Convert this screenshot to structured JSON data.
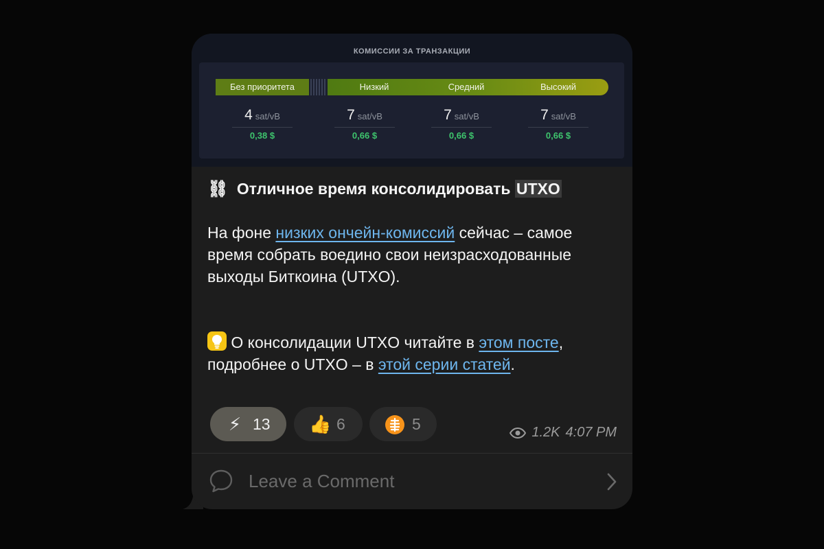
{
  "fee_image": {
    "title": "КОМИССИИ ЗА ТРАНЗАКЦИИ",
    "tiers": [
      {
        "label": "Без приоритета",
        "rate": "4",
        "unit": "sat/vB",
        "usd": "0,38 $"
      },
      {
        "label": "Низкий",
        "rate": "7",
        "unit": "sat/vB",
        "usd": "0,66 $"
      },
      {
        "label": "Средний",
        "rate": "7",
        "unit": "sat/vB",
        "usd": "0,66 $"
      },
      {
        "label": "Высокий",
        "rate": "7",
        "unit": "sat/vB",
        "usd": "0,66 $"
      }
    ]
  },
  "post": {
    "headline_icon": "⛓",
    "headline_prefix": "Отличное время консолидировать",
    "headline_highlight": "UTXO",
    "para1_before": "На фоне",
    "para1_link": "низких ончейн-комиссий",
    "para1_after": "сейчас – самое время собрать воедино свои неизрасходованные выходы Биткоина (UTXO).",
    "para2_icon": "lightbulb-icon",
    "para2_before": "О консолидации UTXO читайте в",
    "para2_link1": "этом посте",
    "para2_middle": ", подробнее о UTXO – в",
    "para2_link2": "этой серии статей",
    "para2_after": "."
  },
  "reactions": [
    {
      "emoji": "⚡",
      "icon": "lightning-icon",
      "count": "13",
      "active": true
    },
    {
      "emoji": "👍",
      "icon": "thumbs-up-icon",
      "count": "6",
      "active": false
    },
    {
      "emoji": "",
      "icon": "coin-icon",
      "count": "5",
      "active": false
    }
  ],
  "meta": {
    "views": "1.2K",
    "time": "4:07 PM"
  },
  "comment": {
    "placeholder": "Leave a Comment"
  },
  "colors": {
    "bubble": "#1d1d1d",
    "link": "#6eb6ee",
    "usd_green": "#3ec46d",
    "active_reaction": "#5c5a53"
  }
}
